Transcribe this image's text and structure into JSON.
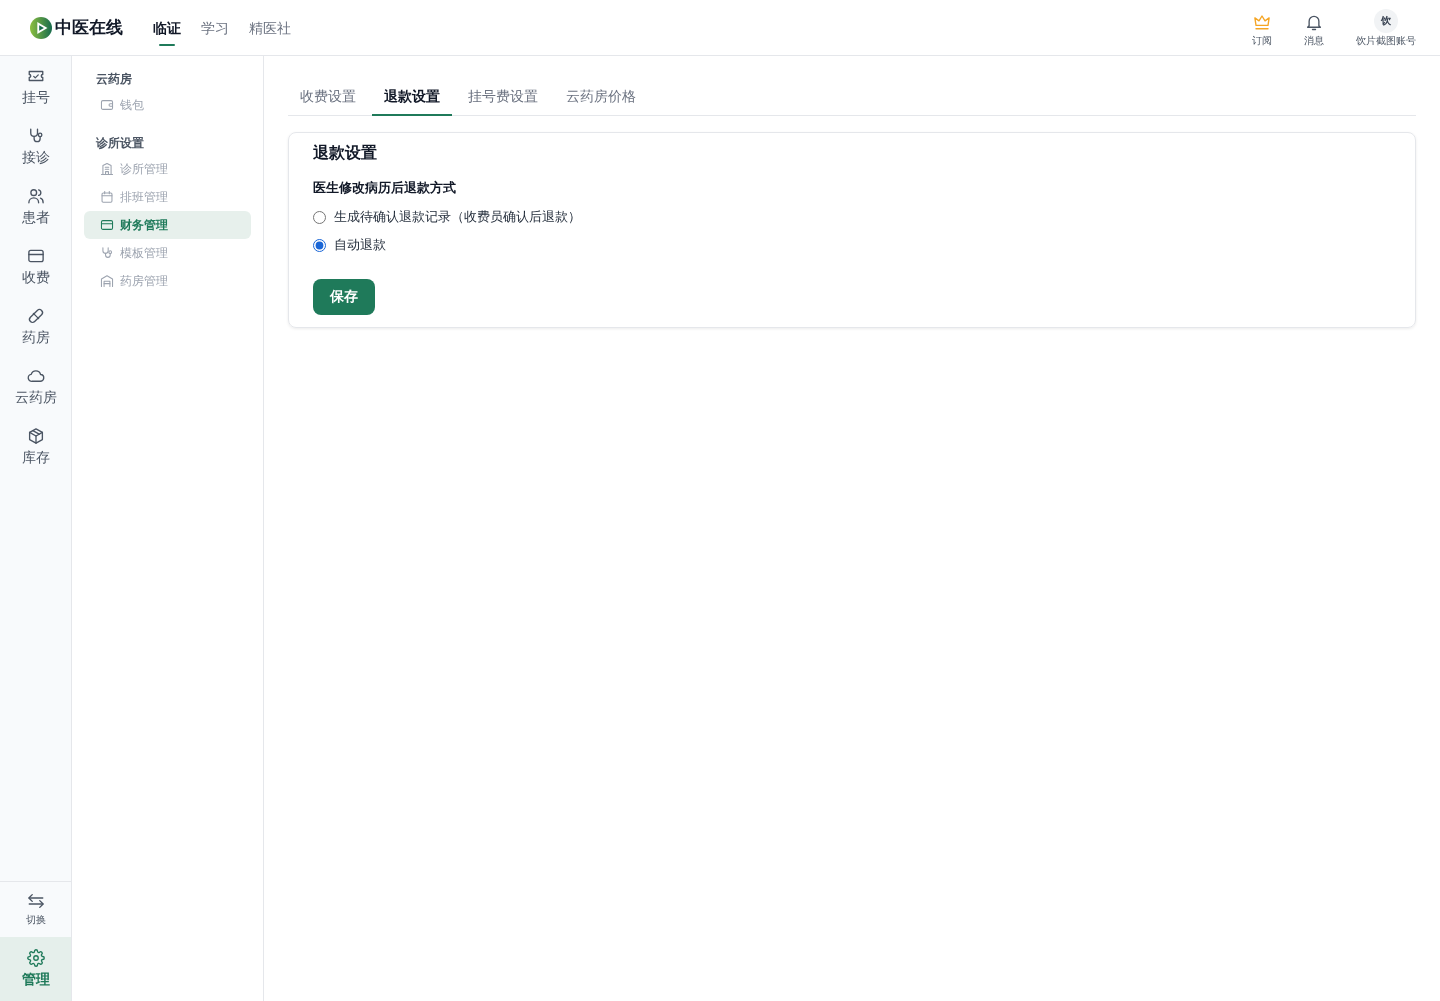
{
  "header": {
    "logo_text": "中医在线",
    "nav": [
      {
        "label": "临证",
        "selected": true
      },
      {
        "label": "学习",
        "selected": false
      },
      {
        "label": "精医社",
        "selected": false
      }
    ],
    "actions": [
      {
        "kind": "crown",
        "label": "订阅"
      },
      {
        "kind": "bell",
        "label": "消息"
      },
      {
        "kind": "avatar",
        "avatar_text": "饮",
        "label": "饮片截图账号"
      }
    ]
  },
  "rail": {
    "items": [
      {
        "kind": "ticket",
        "label": "挂号",
        "selected": false
      },
      {
        "kind": "stethoscope",
        "label": "接诊",
        "selected": false
      },
      {
        "kind": "users",
        "label": "患者",
        "selected": false
      },
      {
        "kind": "card",
        "label": "收费",
        "selected": false
      },
      {
        "kind": "pill",
        "label": "药房",
        "selected": false
      },
      {
        "kind": "cloud",
        "label": "云药房",
        "selected": false
      },
      {
        "kind": "box",
        "label": "库存",
        "selected": false
      }
    ],
    "switch": {
      "kind": "swap",
      "label": "切换"
    },
    "bottom_items": [
      {
        "kind": "gear",
        "label": "管理",
        "selected": true
      }
    ]
  },
  "sidebar": {
    "sections": [
      {
        "title": "云药房",
        "items": [
          {
            "kind": "wallet",
            "label": "钱包",
            "selected": false
          }
        ]
      },
      {
        "title": "诊所设置",
        "items": [
          {
            "kind": "building",
            "label": "诊所管理",
            "selected": false
          },
          {
            "kind": "calendar",
            "label": "排班管理",
            "selected": false
          },
          {
            "kind": "card",
            "label": "财务管理",
            "selected": true
          },
          {
            "kind": "stethoscope",
            "label": "模板管理",
            "selected": false
          },
          {
            "kind": "warehouse",
            "label": "药房管理",
            "selected": false
          }
        ]
      }
    ]
  },
  "tabs": [
    {
      "label": "收费设置",
      "selected": false
    },
    {
      "label": "退款设置",
      "selected": true
    },
    {
      "label": "挂号费设置",
      "selected": false
    },
    {
      "label": "云药房价格",
      "selected": false
    }
  ],
  "card": {
    "title": "退款设置",
    "question": "医生修改病历后退款方式",
    "options": [
      {
        "label": "生成待确认退款记录（收费员确认后退款）",
        "selected": false
      },
      {
        "label": "自动退款",
        "selected": true
      }
    ],
    "save_button": "保存"
  }
}
